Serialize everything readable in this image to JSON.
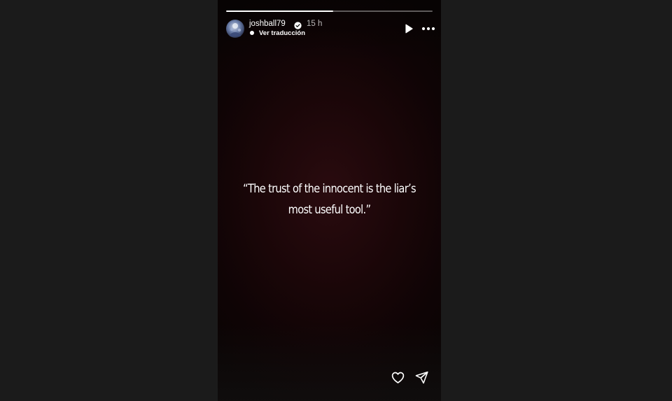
{
  "story": {
    "username": "joshball79",
    "verified_icon": "verified-badge-icon",
    "time_ago": "15 h",
    "translate_label": "Ver traducción",
    "quote": "“The trust of the innocent is the liar’s most useful tool.”",
    "progress_fraction": 0.52,
    "background_color": "#1b0608",
    "page_background": "#1b1b1b"
  },
  "controls": {
    "play_icon": "play-icon",
    "more_icon": "more-options-icon",
    "like_icon": "heart-icon",
    "share_icon": "send-icon"
  }
}
